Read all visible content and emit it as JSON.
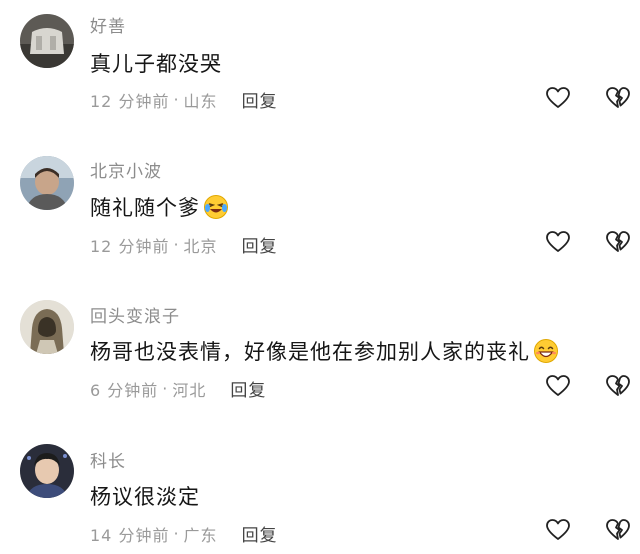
{
  "comments": [
    {
      "username": "好善",
      "text": "真儿子都没哭",
      "time": "12 分钟前",
      "location": "山东",
      "reply_label": "回复",
      "emoji": "",
      "avatar": "stone-avatar"
    },
    {
      "username": "北京小波",
      "text": "随礼随个爹",
      "time": "12 分钟前",
      "location": "北京",
      "reply_label": "回复",
      "emoji": "laughing-crying-emoji",
      "avatar": "person-avatar"
    },
    {
      "username": "回头变浪子",
      "text": "杨哥也没表情，好像是他在参加别人家的丧礼",
      "time": "6 分钟前",
      "location": "河北",
      "reply_label": "回复",
      "emoji": "grinning-emoji",
      "avatar": "hooded-figure-avatar"
    },
    {
      "username": "科长",
      "text": "杨议很淡定",
      "time": "14 分钟前",
      "location": "广东",
      "reply_label": "回复",
      "emoji": "",
      "avatar": "man-portrait-avatar"
    }
  ],
  "separator": "·",
  "icons": {
    "like": "heart-icon",
    "dislike": "broken-heart-icon"
  },
  "colors": {
    "username": "#8c8c8c",
    "text": "#161616",
    "meta": "#9a9a9a",
    "reply": "#444444"
  }
}
